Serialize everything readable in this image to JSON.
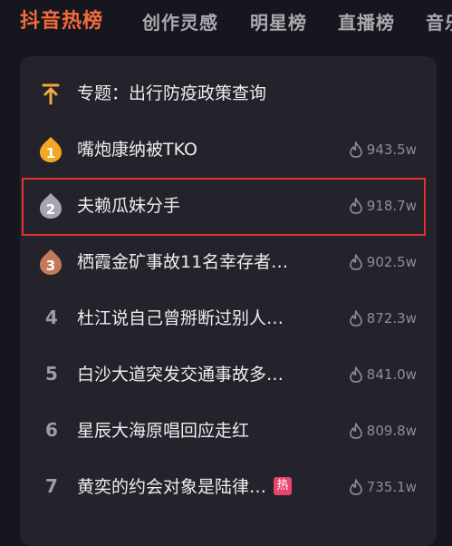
{
  "tabs": [
    {
      "label": "抖音热榜",
      "active": true
    },
    {
      "label": "创作灵感",
      "active": false
    },
    {
      "label": "明星榜",
      "active": false
    },
    {
      "label": "直播榜",
      "active": false
    },
    {
      "label": "音乐",
      "active": false
    }
  ],
  "topic": {
    "label": "专题：出行防疫政策查询"
  },
  "items": [
    {
      "rank": "1",
      "title": "嘴炮康纳被TKO",
      "heat": "943.5w",
      "medal": "gold"
    },
    {
      "rank": "2",
      "title": "夫赖瓜妹分手",
      "heat": "918.7w",
      "medal": "silver",
      "highlighted": true
    },
    {
      "rank": "3",
      "title": "栖霞金矿事故11名幸存者…",
      "heat": "902.5w",
      "medal": "bronze"
    },
    {
      "rank": "4",
      "title": "杜江说自己曾掰断过别人…",
      "heat": "872.3w"
    },
    {
      "rank": "5",
      "title": "白沙大道突发交通事故多…",
      "heat": "841.0w"
    },
    {
      "rank": "6",
      "title": "星辰大海原唱回应走红",
      "heat": "809.8w"
    },
    {
      "rank": "7",
      "title": "黄奕的约会对象是陆律…",
      "heat": "735.1w",
      "badge": "热"
    }
  ],
  "colors": {
    "accent": "#f26b3a",
    "highlight_border": "#e0322f",
    "hot_badge": "#e8456c"
  }
}
